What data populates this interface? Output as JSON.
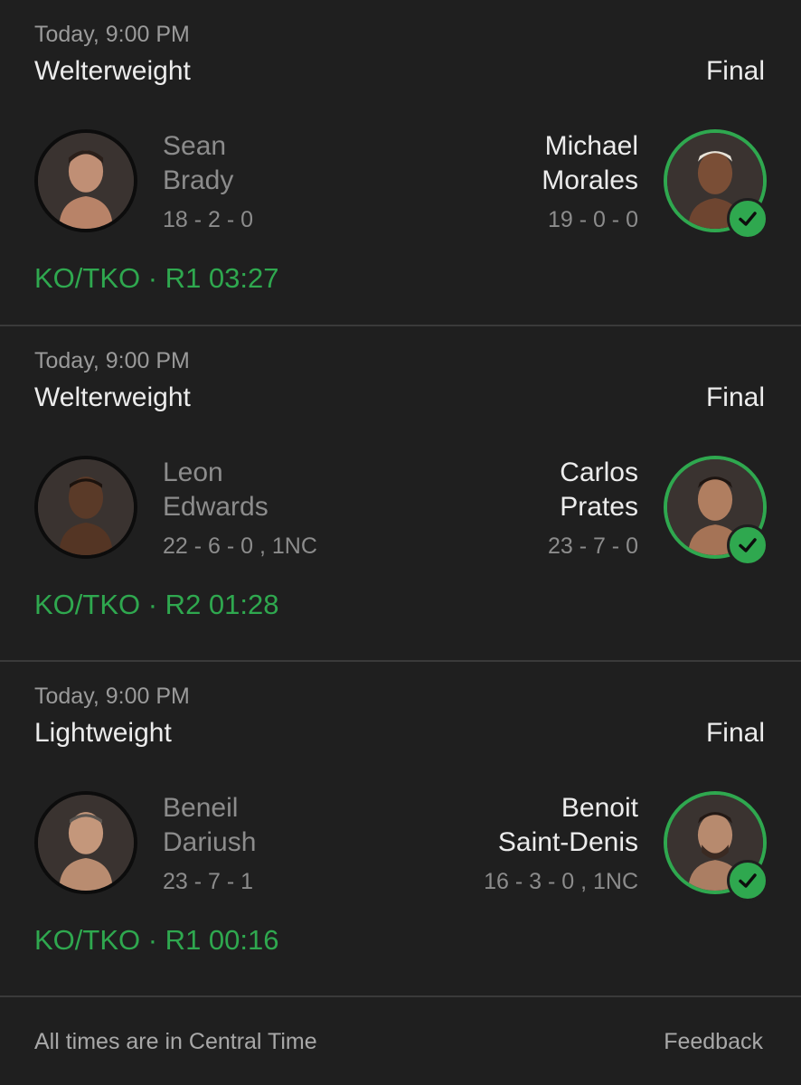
{
  "fights": [
    {
      "time": "Today, 9:00 PM",
      "division": "Welterweight",
      "status": "Final",
      "left": {
        "first": "Sean",
        "last": "Brady",
        "record": "18 - 2 - 0"
      },
      "right": {
        "first": "Michael",
        "last": "Morales",
        "record": "19 - 0 - 0"
      },
      "result": "KO/TKO · R1 03:27"
    },
    {
      "time": "Today, 9:00 PM",
      "division": "Welterweight",
      "status": "Final",
      "left": {
        "first": "Leon",
        "last": "Edwards",
        "record": "22 - 6 - 0 , 1NC"
      },
      "right": {
        "first": "Carlos",
        "last": "Prates",
        "record": "23 - 7 - 0"
      },
      "result": "KO/TKO · R2 01:28"
    },
    {
      "time": "Today, 9:00 PM",
      "division": "Lightweight",
      "status": "Final",
      "left": {
        "first": "Beneil",
        "last": "Dariush",
        "record": "23 - 7 - 1"
      },
      "right": {
        "first": "Benoit",
        "last": "Saint-Denis",
        "record": "16 - 3 - 0 , 1NC"
      },
      "result": "KO/TKO · R1 00:16"
    }
  ],
  "footer": {
    "note": "All times are in Central Time",
    "feedback": "Feedback"
  },
  "colors": {
    "background": "#1f1f1f",
    "win_green": "#2fa84f",
    "divider": "#3a3a3a"
  },
  "icons": {
    "winner": "checkmark-icon"
  }
}
